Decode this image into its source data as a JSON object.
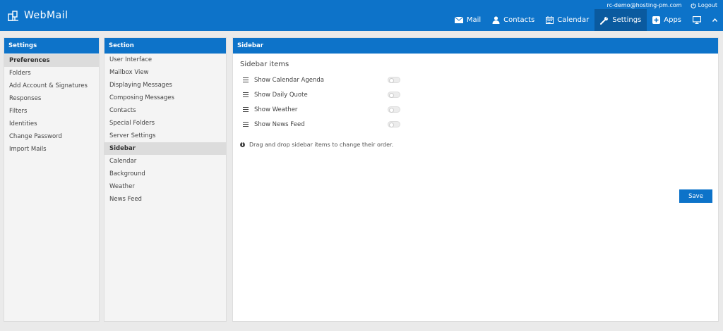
{
  "app": {
    "title": "WebMail"
  },
  "user": {
    "email": "rc-demo@hosting-pm.com",
    "logout_label": "Logout"
  },
  "nav": {
    "mail": "Mail",
    "contacts": "Contacts",
    "calendar": "Calendar",
    "settings": "Settings",
    "apps": "Apps"
  },
  "settings_panel": {
    "header": "Settings",
    "items": [
      "Preferences",
      "Folders",
      "Add Account & Signatures",
      "Responses",
      "Filters",
      "Identities",
      "Change Password",
      "Import Mails"
    ],
    "selected": "Preferences"
  },
  "section_panel": {
    "header": "Section",
    "items": [
      "User Interface",
      "Mailbox View",
      "Displaying Messages",
      "Composing Messages",
      "Contacts",
      "Special Folders",
      "Server Settings",
      "Sidebar",
      "Calendar",
      "Background",
      "Weather",
      "News Feed"
    ],
    "selected": "Sidebar"
  },
  "content": {
    "header": "Sidebar",
    "group_title": "Sidebar items",
    "items": [
      {
        "label": "Show Calendar Agenda",
        "enabled": false
      },
      {
        "label": "Show Daily Quote",
        "enabled": false
      },
      {
        "label": "Show Weather",
        "enabled": false
      },
      {
        "label": "Show News Feed",
        "enabled": false
      }
    ],
    "hint": "Drag and drop sidebar items to change their order.",
    "save_label": "Save"
  },
  "colors": {
    "accent": "#0d73c9",
    "accent_dark": "#0a5a9f"
  }
}
